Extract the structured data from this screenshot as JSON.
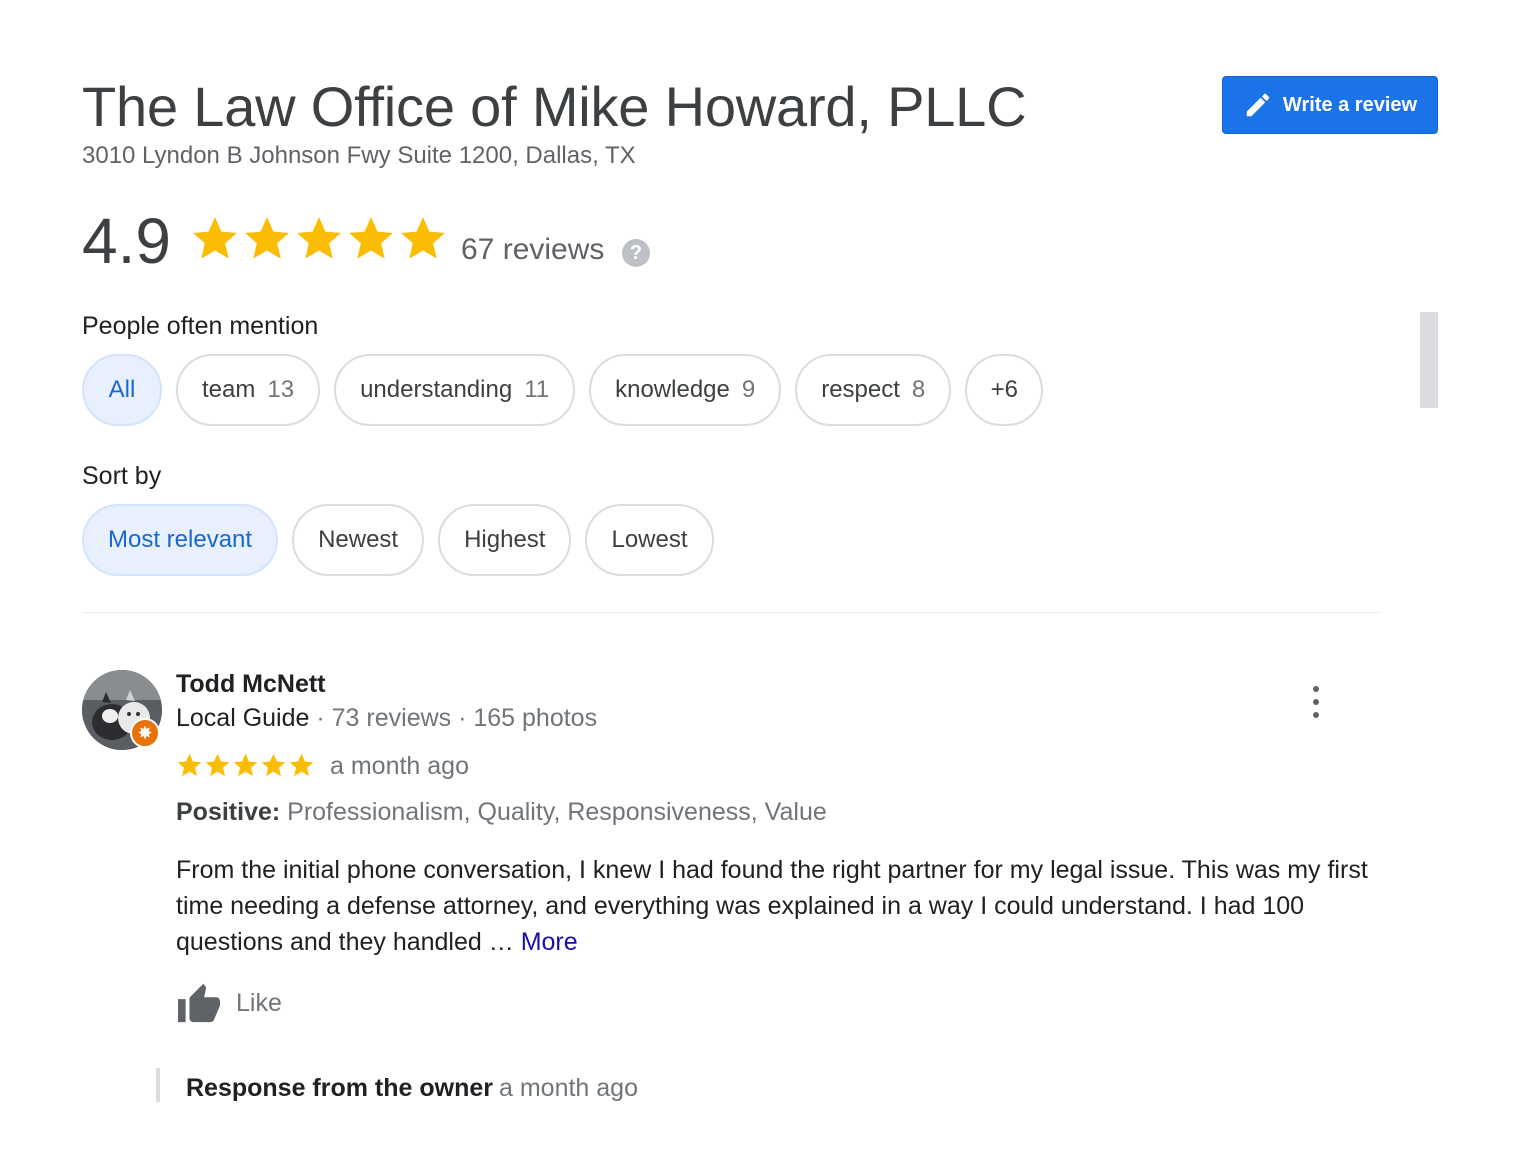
{
  "business": {
    "name": "The Law Office of Mike Howard, PLLC",
    "address": "3010 Lyndon B Johnson Fwy Suite 1200, Dallas, TX"
  },
  "write_review": {
    "label": "Write a review",
    "icon": "pencil-icon"
  },
  "rating": {
    "value": "4.9",
    "stars": 5,
    "reviews_label": "67 reviews",
    "help_icon": "?"
  },
  "mentions": {
    "label": "People often mention",
    "chips": [
      {
        "label": "All",
        "count": ""
      },
      {
        "label": "team",
        "count": "13"
      },
      {
        "label": "understanding",
        "count": "11"
      },
      {
        "label": "knowledge",
        "count": "9"
      },
      {
        "label": "respect",
        "count": "8"
      },
      {
        "label": "+6",
        "count": ""
      }
    ],
    "active_index": 0
  },
  "sort": {
    "label": "Sort by",
    "options": [
      "Most relevant",
      "Newest",
      "Highest",
      "Lowest"
    ],
    "active_index": 0
  },
  "review": {
    "author": "Todd McNett",
    "guide_label": "Local Guide",
    "stats": " · 73 reviews · 165 photos",
    "stars": 5,
    "time": "a month ago",
    "positive_label": "Positive:",
    "positive_values": " Professionalism, Quality, Responsiveness, Value",
    "text": "From the initial phone conversation, I knew I had found the right partner for my legal issue. This was my first time needing a defense attorney, and everything was explained in a way I could understand. I had 100 questions and they handled … ",
    "more_label": "More",
    "like_label": "Like",
    "response_title": "Response from the owner",
    "response_time": "a month ago"
  },
  "colors": {
    "star": "#fbbc04",
    "accent_blue": "#1a73e8",
    "chip_active_bg": "#e8f0fe",
    "link": "#1a0dab",
    "guide_badge": "#e8710a"
  }
}
